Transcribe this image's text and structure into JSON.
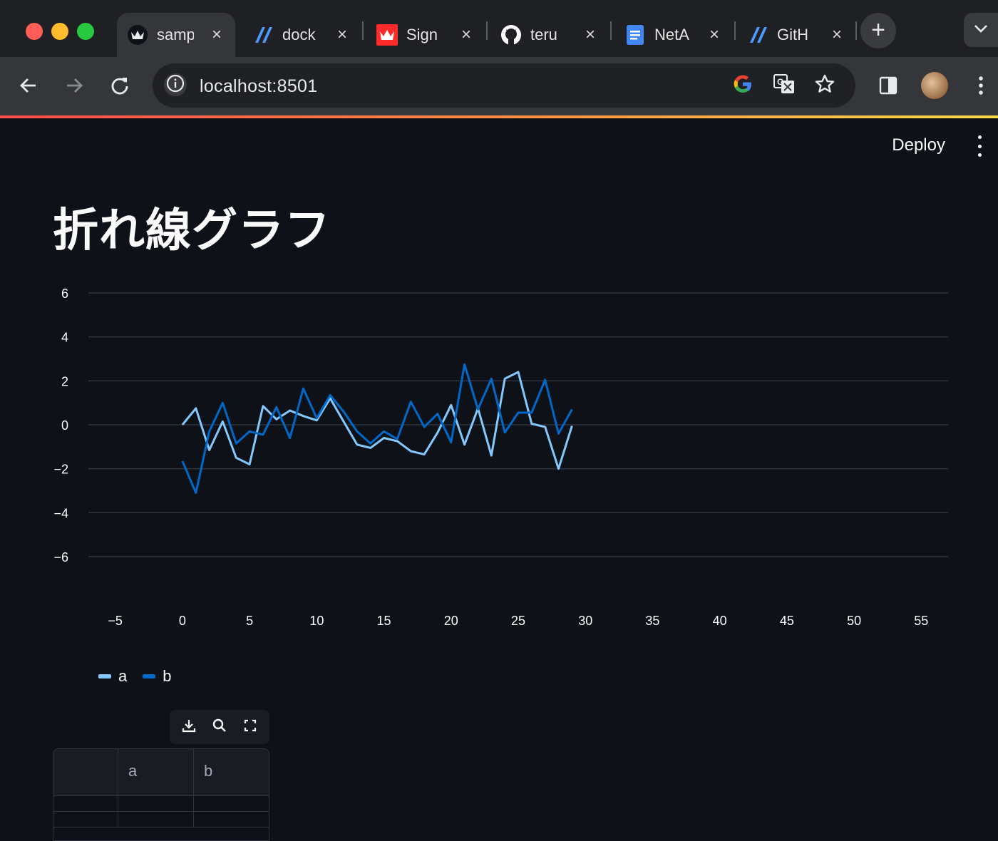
{
  "browser": {
    "tabs": [
      {
        "title": "samp",
        "icon": "streamlit-crown-icon",
        "active": true
      },
      {
        "title": "dock",
        "icon": "streamlit-slash-icon",
        "active": false
      },
      {
        "title": "Sign",
        "icon": "red-crown-icon",
        "active": false
      },
      {
        "title": "teru",
        "icon": "github-icon",
        "active": false
      },
      {
        "title": "NetA",
        "icon": "google-docs-icon",
        "active": false
      },
      {
        "title": "GitH",
        "icon": "streamlit-slash-icon",
        "active": false
      }
    ],
    "new_tab_label": "+",
    "close_label": "×",
    "url": "localhost:8501"
  },
  "header": {
    "deploy_label": "Deploy"
  },
  "page": {
    "title": "折れ線グラフ"
  },
  "chart_data": {
    "type": "line",
    "x": [
      0,
      1,
      2,
      3,
      4,
      5,
      6,
      7,
      8,
      9,
      10,
      11,
      12,
      13,
      14,
      15,
      16,
      17,
      18,
      19,
      20,
      21,
      22,
      23,
      24,
      25,
      26,
      27,
      28,
      29
    ],
    "series": [
      {
        "name": "a",
        "color": "#83c9ff",
        "values": [
          0.0,
          0.75,
          -1.15,
          0.15,
          -1.5,
          -1.8,
          0.85,
          0.25,
          0.65,
          0.4,
          0.2,
          1.2,
          0.15,
          -0.9,
          -1.05,
          -0.6,
          -0.75,
          -1.2,
          -1.35,
          -0.35,
          0.9,
          -0.9,
          0.75,
          -1.4,
          2.1,
          2.4,
          0.05,
          -0.1,
          -2.0,
          -0.05
        ]
      },
      {
        "name": "b",
        "color": "#0068c9",
        "values": [
          -1.65,
          -3.1,
          -0.3,
          1.0,
          -0.85,
          -0.3,
          -0.45,
          0.8,
          -0.6,
          1.65,
          0.3,
          1.35,
          0.6,
          -0.3,
          -0.85,
          -0.3,
          -0.65,
          1.05,
          -0.1,
          0.5,
          -0.8,
          2.75,
          0.7,
          2.1,
          -0.35,
          0.55,
          0.55,
          2.05,
          -0.4,
          0.7
        ]
      }
    ],
    "xlim": [
      -7,
      57
    ],
    "ylim": [
      -7,
      7
    ],
    "xticks": [
      -5,
      0,
      5,
      10,
      15,
      20,
      25,
      30,
      35,
      40,
      45,
      50,
      55
    ],
    "yticks": [
      6,
      4,
      2,
      0,
      -2,
      -4,
      -6
    ],
    "grid": true,
    "legend": "bottom-left"
  },
  "dataframe": {
    "columns": [
      "",
      "a",
      "b"
    ]
  }
}
